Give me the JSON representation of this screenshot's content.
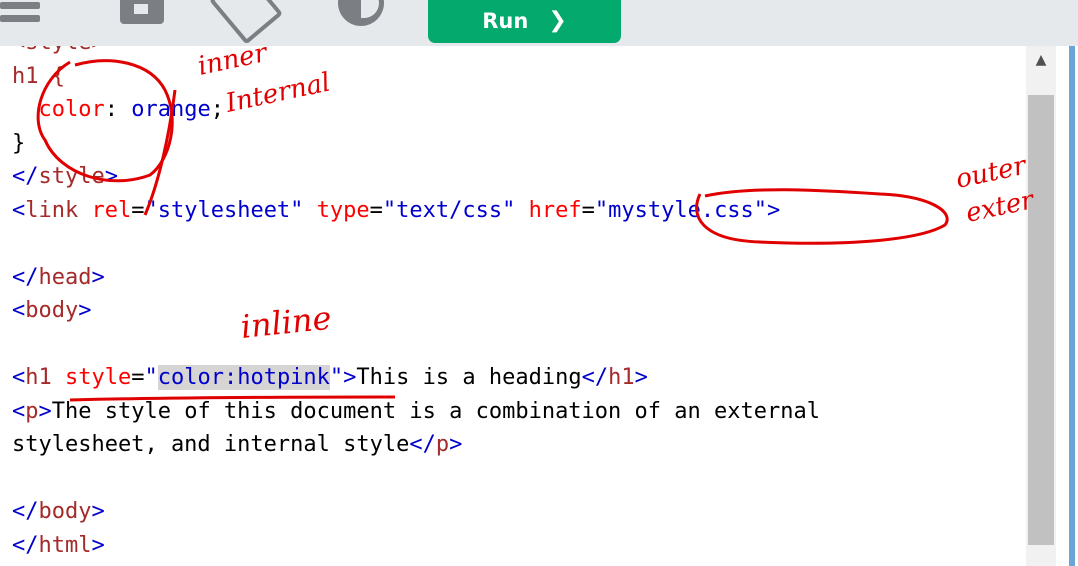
{
  "toolbar": {
    "run_label": "Run",
    "run_arrow": "❯",
    "icons": [
      "menu-icon",
      "save-icon",
      "rotate-icon",
      "theme-icon"
    ]
  },
  "editor": {
    "lines": [
      [
        {
          "t": "<style>",
          "c": "tag"
        }
      ],
      [
        {
          "t": "h1 {",
          "c": "tag"
        }
      ],
      [
        {
          "t": "  ",
          "c": ""
        },
        {
          "t": "color",
          "c": "prop"
        },
        {
          "t": ": ",
          "c": ""
        },
        {
          "t": "orange",
          "c": "val"
        },
        {
          "t": ";",
          "c": ""
        }
      ],
      [
        {
          "t": "}",
          "c": ""
        }
      ],
      [
        {
          "t": "</",
          "c": "br"
        },
        {
          "t": "style",
          "c": "tag"
        },
        {
          "t": ">",
          "c": "br"
        }
      ],
      [
        {
          "t": "<",
          "c": "br"
        },
        {
          "t": "link ",
          "c": "tag"
        },
        {
          "t": "rel",
          "c": "attr"
        },
        {
          "t": "=",
          "c": ""
        },
        {
          "t": "\"stylesheet\"",
          "c": "val"
        },
        {
          "t": " ",
          "c": ""
        },
        {
          "t": "type",
          "c": "attr"
        },
        {
          "t": "=",
          "c": ""
        },
        {
          "t": "\"text/css\"",
          "c": "val"
        },
        {
          "t": " ",
          "c": ""
        },
        {
          "t": "href",
          "c": "attr"
        },
        {
          "t": "=",
          "c": ""
        },
        {
          "t": "\"mystyle.css\"",
          "c": "val"
        },
        {
          "t": ">",
          "c": "br"
        }
      ],
      [
        {
          "t": "",
          "c": ""
        }
      ],
      [
        {
          "t": "</",
          "c": "br"
        },
        {
          "t": "head",
          "c": "tag"
        },
        {
          "t": ">",
          "c": "br"
        }
      ],
      [
        {
          "t": "<",
          "c": "br"
        },
        {
          "t": "body",
          "c": "tag"
        },
        {
          "t": ">",
          "c": "br"
        }
      ],
      [
        {
          "t": "",
          "c": ""
        }
      ],
      [
        {
          "t": "<",
          "c": "br"
        },
        {
          "t": "h1 ",
          "c": "tag"
        },
        {
          "t": "style",
          "c": "attr"
        },
        {
          "t": "=",
          "c": ""
        },
        {
          "t": "\"",
          "c": "val"
        },
        {
          "t": "color:hotpink",
          "c": "val sel"
        },
        {
          "t": "\"",
          "c": "val"
        },
        {
          "t": ">",
          "c": "br"
        },
        {
          "t": "This is a heading",
          "c": ""
        },
        {
          "t": "</",
          "c": "br"
        },
        {
          "t": "h1",
          "c": "tag"
        },
        {
          "t": ">",
          "c": "br"
        }
      ],
      [
        {
          "t": "<",
          "c": "br"
        },
        {
          "t": "p",
          "c": "tag"
        },
        {
          "t": ">",
          "c": "br"
        },
        {
          "t": "The style of this document is a combination of an external",
          "c": ""
        }
      ],
      [
        {
          "t": "stylesheet, and internal style",
          "c": ""
        },
        {
          "t": "</",
          "c": "br"
        },
        {
          "t": "p",
          "c": "tag"
        },
        {
          "t": ">",
          "c": "br"
        }
      ],
      [
        {
          "t": "",
          "c": ""
        }
      ],
      [
        {
          "t": "</",
          "c": "br"
        },
        {
          "t": "body",
          "c": "tag"
        },
        {
          "t": ">",
          "c": "br"
        }
      ],
      [
        {
          "t": "</",
          "c": "br"
        },
        {
          "t": "html",
          "c": "tag"
        },
        {
          "t": ">",
          "c": "br"
        }
      ]
    ]
  },
  "annotations": {
    "inner": "inner",
    "internal": "Internal",
    "outer": "outer",
    "external": "exter",
    "inline": "inline"
  },
  "colors": {
    "run_bg": "#04aa6d",
    "toolbar_bg": "#e6e9ec",
    "ink": "#e00000"
  }
}
